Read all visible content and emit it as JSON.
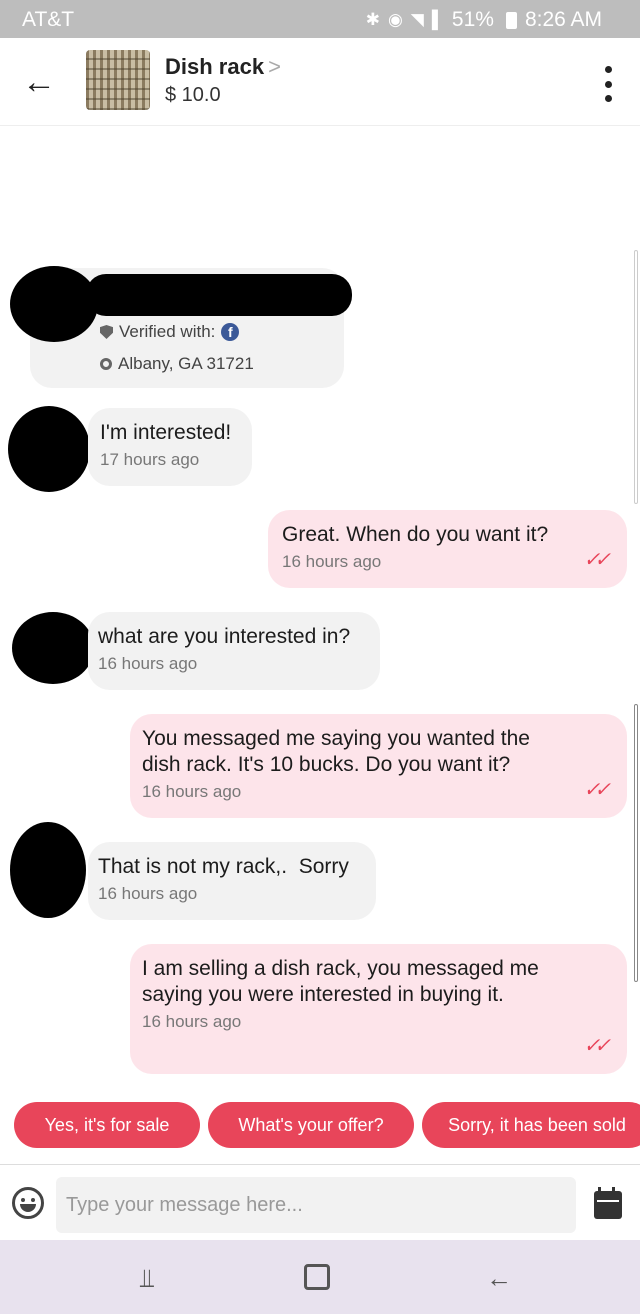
{
  "status_bar": {
    "carrier": "AT&T",
    "battery": "51%",
    "time": "8:26 AM",
    "icons": [
      "bluetooth-icon",
      "alarm-icon",
      "wifi-icon",
      "signal-icon",
      "battery-icon"
    ]
  },
  "header": {
    "title": "Dish rack",
    "chevron": ">",
    "price": "$ 10.0",
    "back_icon": "arrow-left-icon",
    "more_icon": "more-vertical-icon"
  },
  "profile": {
    "verified_label": "Verified with:",
    "verified_provider": "f",
    "location": "Albany, GA 31721"
  },
  "messages": [
    {
      "direction": "in",
      "text": "I'm interested!",
      "time": "17 hours ago"
    },
    {
      "direction": "out",
      "text": "Great. When do you want it?",
      "time": "16 hours ago"
    },
    {
      "direction": "in",
      "text": "what are you interested in?",
      "time": "16 hours ago"
    },
    {
      "direction": "out",
      "text": "You messaged me saying you wanted the dish rack. It's 10 bucks. Do you want it?",
      "time": "16 hours ago"
    },
    {
      "direction": "in",
      "text": "That is not my rack,.  Sorry",
      "time": "16 hours ago"
    },
    {
      "direction": "out",
      "text": "I am selling a dish rack, you messaged me saying you were interested in buying it.",
      "time": "16 hours ago"
    }
  ],
  "read_mark": "✓✓",
  "quick_replies": [
    "Yes, it's for sale",
    "What's your offer?",
    "Sorry, it has been sold"
  ],
  "input": {
    "placeholder": "Type your message here..."
  },
  "colors": {
    "accent": "#e8455a",
    "outgoing_bubble": "#fde4ea",
    "incoming_bubble": "#f2f2f2",
    "status_bar": "#bdbdbd",
    "nav_bar": "#e8e2ee"
  }
}
